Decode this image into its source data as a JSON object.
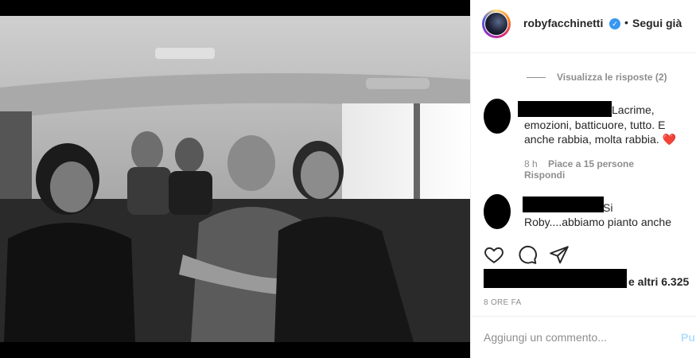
{
  "post": {
    "username": "robyfacchinetti",
    "verified_icon": "verified-badge-icon",
    "separator": "•",
    "follow_label": "Segui già",
    "image_alt": "Black-and-white group photo of five men seated in a van"
  },
  "comments": {
    "view_replies": "Visualizza le risposte (2)",
    "items": [
      {
        "text_lines": [
          "Lacrime,",
          "emozioni, batticuore, tutto. E",
          "anche rabbia, molta rabbia."
        ],
        "emoji": "❤️",
        "age": "8 h",
        "likes": "Piace a 15 persone",
        "reply": "Rispondi"
      },
      {
        "text_lines": [
          "Si",
          "Roby....abbiamo pianto anche"
        ]
      }
    ]
  },
  "actions": {
    "like_icon": "heart-icon",
    "comment_icon": "comment-icon",
    "share_icon": "share-icon"
  },
  "likes": {
    "text": "e altri 6.325"
  },
  "timestamp": "8 ORE FA",
  "composer": {
    "placeholder": "Aggiungi un commento...",
    "publish_label": "Pu"
  },
  "colors": {
    "accent": "#3897f0",
    "heart": "#ed4956",
    "muted": "#8e8e8e",
    "publish_disabled": "#b2dffc"
  }
}
